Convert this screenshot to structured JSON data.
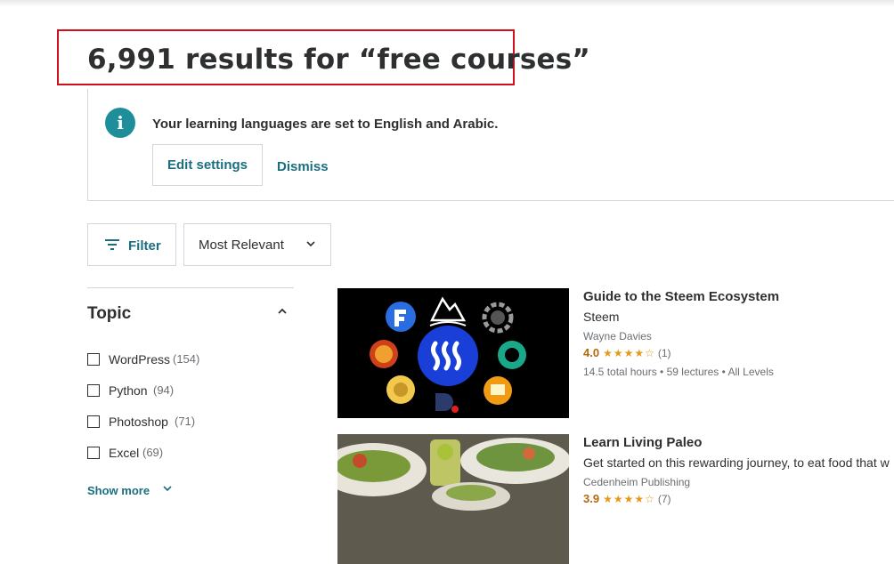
{
  "search": {
    "results_title": "6,991 results for “free courses”"
  },
  "notice": {
    "info_icon": "i",
    "message": "Your learning languages are set to English and Arabic.",
    "edit_label": "Edit settings",
    "dismiss_label": "Dismiss"
  },
  "toolbar": {
    "filter_label": "Filter",
    "sort_value": "Most Relevant",
    "chevron": "⌄"
  },
  "sidebar": {
    "section_title": "Topic",
    "collapse_chevron": "⌃",
    "options": [
      {
        "label": "WordPress",
        "count": "(154)"
      },
      {
        "label": "Python",
        "count": "(94)"
      },
      {
        "label": "Photoshop",
        "count": "(71)"
      },
      {
        "label": "Excel",
        "count": "(69)"
      }
    ],
    "show_more": "Show more",
    "show_more_chevron": "⌄"
  },
  "courses": [
    {
      "title": "Guide to the Steem Ecosystem",
      "description": "Steem",
      "author": "Wayne Davies",
      "rating": "4.0",
      "stars": "★★★★☆",
      "rating_count": "(1)",
      "meta": "14.5 total hours • 59 lectures • All Levels"
    },
    {
      "title": "Learn Living Paleo",
      "description": "Get started on this rewarding journey, to eat food that w",
      "author": "Cedenheim Publishing",
      "rating": "3.9",
      "stars": "★★★★☆",
      "rating_count": "(7)"
    }
  ],
  "colors": {
    "accent": "#1a6e80",
    "highlight_border": "#d0111b",
    "rating": "#b4690e",
    "star": "#e59819"
  }
}
